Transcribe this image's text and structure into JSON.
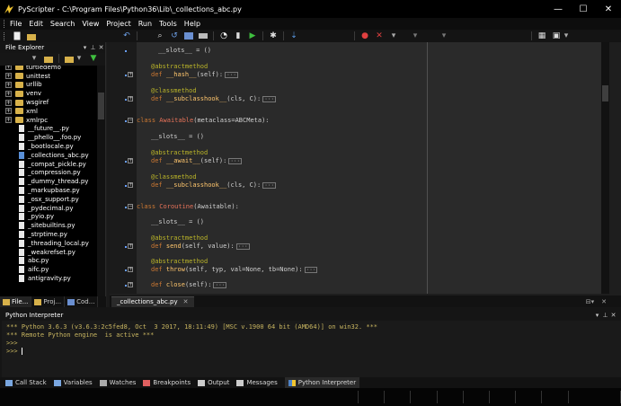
{
  "window": {
    "title": "PyScripter - C:\\Program Files\\Python36\\Lib\\_collections_abc.py",
    "minimize": "—",
    "maximize": "☐",
    "close": "✕"
  },
  "menu": [
    "File",
    "Edit",
    "Search",
    "View",
    "Project",
    "Run",
    "Tools",
    "Help"
  ],
  "explorer": {
    "title": "File Explorer",
    "items": [
      {
        "name": "turtledemo",
        "kind": "folder"
      },
      {
        "name": "unittest",
        "kind": "folder"
      },
      {
        "name": "urllib",
        "kind": "folder"
      },
      {
        "name": "venv",
        "kind": "folder"
      },
      {
        "name": "wsgiref",
        "kind": "folder"
      },
      {
        "name": "xml",
        "kind": "folder"
      },
      {
        "name": "xmlrpc",
        "kind": "folder"
      },
      {
        "name": "__future__.py",
        "kind": "file"
      },
      {
        "name": "__phello__.foo.py",
        "kind": "file"
      },
      {
        "name": "_bootlocale.py",
        "kind": "file"
      },
      {
        "name": "_collections_abc.py",
        "kind": "file-active"
      },
      {
        "name": "_compat_pickle.py",
        "kind": "file"
      },
      {
        "name": "_compression.py",
        "kind": "file"
      },
      {
        "name": "_dummy_thread.py",
        "kind": "file"
      },
      {
        "name": "_markupbase.py",
        "kind": "file"
      },
      {
        "name": "_osx_support.py",
        "kind": "file"
      },
      {
        "name": "_pydecimal.py",
        "kind": "file"
      },
      {
        "name": "_pyio.py",
        "kind": "file"
      },
      {
        "name": "_sitebuiltins.py",
        "kind": "file"
      },
      {
        "name": "_strptime.py",
        "kind": "file"
      },
      {
        "name": "_threading_local.py",
        "kind": "file"
      },
      {
        "name": "_weakrefset.py",
        "kind": "file"
      },
      {
        "name": "abc.py",
        "kind": "file"
      },
      {
        "name": "aifc.py",
        "kind": "file"
      },
      {
        "name": "antigravity.py",
        "kind": "file"
      }
    ],
    "tabs": [
      "File...",
      "Proj...",
      "Cod..."
    ]
  },
  "editor": {
    "tab_label": "_collections_abc.py",
    "lines": {
      "l1": "__slots__ = ()",
      "l2": "@abstractmethod",
      "l3a": "def ",
      "l3b": "__hash__",
      "l3c": "(self):",
      "l4": "@classmethod",
      "l5a": "def ",
      "l5b": "__subclasshook__",
      "l5c": "(cls, C):",
      "l6a": "class ",
      "l6b": "Awaitable",
      "l6c": "(metaclass=ABCMeta):",
      "l7": "__slots__ = ()",
      "l8": "@abstractmethod",
      "l9a": "def ",
      "l9b": "__await__",
      "l9c": "(self):",
      "l10": "@classmethod",
      "l11a": "def ",
      "l11b": "__subclasshook__",
      "l11c": "(cls, C):",
      "l12a": "class ",
      "l12b": "Coroutine",
      "l12c": "(Awaitable):",
      "l13": "__slots__ = ()",
      "l14": "@abstractmethod",
      "l15a": "def ",
      "l15b": "send",
      "l15c": "(self, value):",
      "l16": "@abstractmethod",
      "l17a": "def ",
      "l17b": "throw",
      "l17c": "(self, typ, val=None, tb=None):",
      "l18a": "def ",
      "l18b": "close",
      "l18c": "(self):"
    },
    "fold_dots": "···"
  },
  "interpreter": {
    "title": "Python Interpreter",
    "lines": [
      "*** Python 3.6.3 (v3.6.3:2c5fed8, Oct  3 2017, 18:11:49) [MSC v.1900 64 bit (AMD64)] on win32. ***",
      "*** Remote Python engine  is active ***",
      ">>>",
      ">>> "
    ]
  },
  "bottom_tabs": [
    "Call Stack",
    "Variables",
    "Watches",
    "Breakpoints",
    "Output",
    "Messages",
    "Python Interpreter"
  ],
  "colors": {
    "keyword": "#cc7832",
    "decorator": "#bbb529",
    "function": "#ffc66d",
    "class_name": "#e8735a",
    "console_text": "#c8b560"
  }
}
